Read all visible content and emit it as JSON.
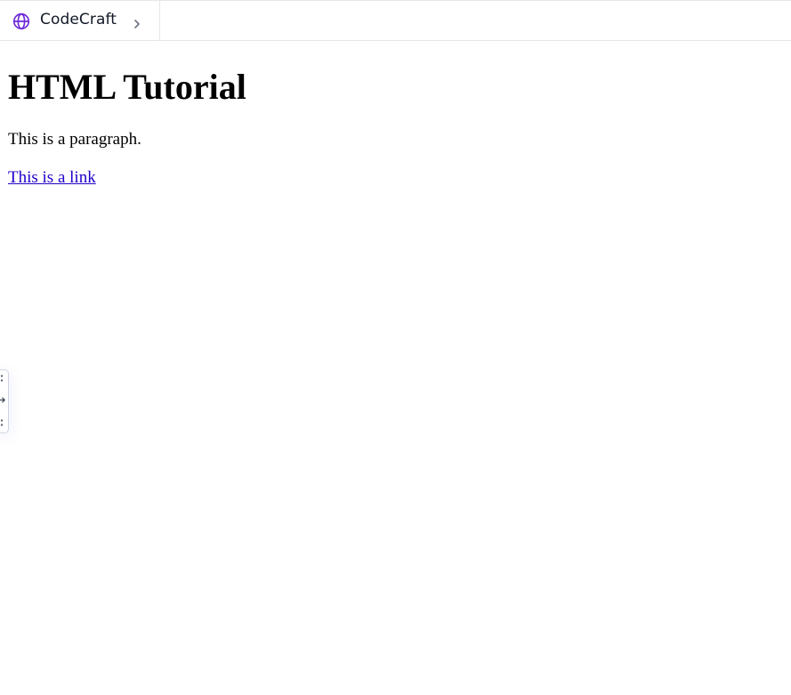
{
  "header": {
    "site_name": "CodeCraft",
    "globe_icon": "globe-icon",
    "chevron_icon": "chevron-right-icon",
    "accent_color": "#6d28d9"
  },
  "main": {
    "title": "HTML Tutorial",
    "paragraph": "This is a paragraph.",
    "link_text": "This is a link",
    "link_color": "#1f00c9"
  },
  "side_handle": {
    "icons": [
      "drag-dots-icon",
      "arrow-right-icon",
      "drag-dots-icon"
    ]
  }
}
